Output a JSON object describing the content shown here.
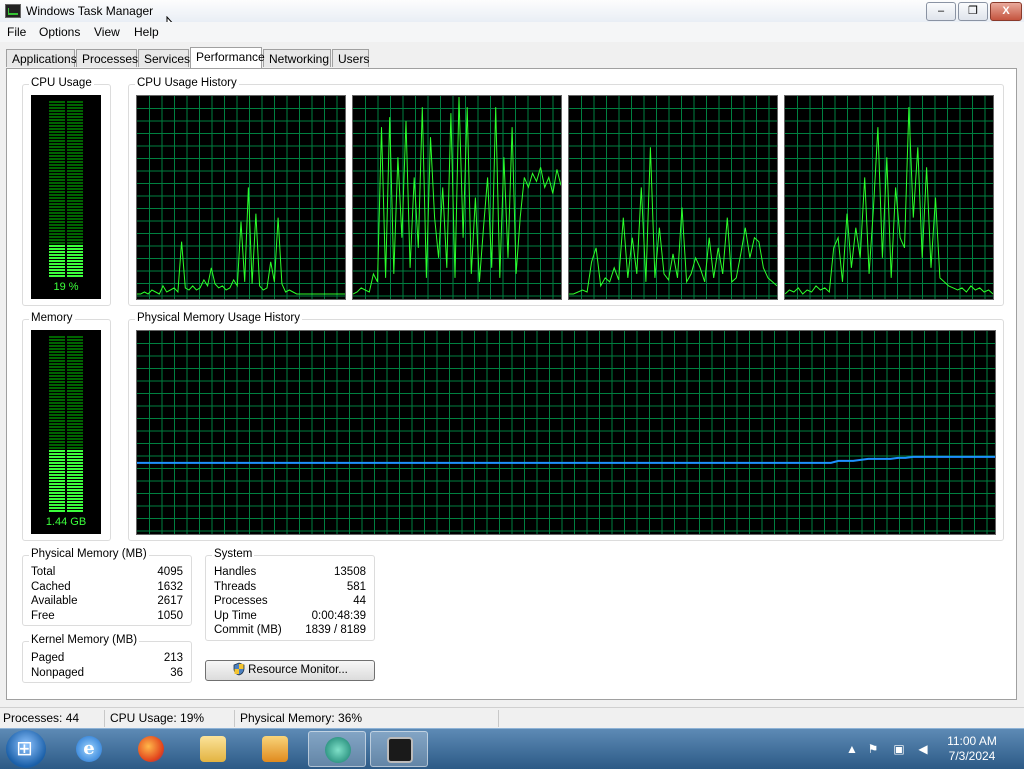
{
  "window": {
    "title": "Windows Task Manager",
    "min": "‒",
    "max": "❐",
    "close": "X"
  },
  "menu": [
    "File",
    "Options",
    "View",
    "Help"
  ],
  "tabs": [
    {
      "label": "Applications",
      "active": false
    },
    {
      "label": "Processes",
      "active": false
    },
    {
      "label": "Services",
      "active": false
    },
    {
      "label": "Performance",
      "active": true
    },
    {
      "label": "Networking",
      "active": false
    },
    {
      "label": "Users",
      "active": false
    }
  ],
  "cpu": {
    "label": "CPU Usage",
    "value_text": "19 %",
    "level": 0.19,
    "history_label": "CPU Usage History",
    "cores": [
      [
        2,
        2,
        3,
        2,
        4,
        3,
        2,
        6,
        3,
        4,
        5,
        3,
        28,
        5,
        4,
        6,
        4,
        5,
        9,
        6,
        15,
        7,
        5,
        6,
        4,
        5,
        9,
        6,
        38,
        8,
        55,
        7,
        42,
        6,
        4,
        5,
        18,
        8,
        40,
        7,
        3,
        4,
        3,
        2,
        2,
        2,
        2,
        2,
        2,
        2,
        2,
        2,
        2,
        2,
        2,
        2,
        2
      ],
      [
        2,
        3,
        5,
        4,
        3,
        12,
        8,
        85,
        10,
        90,
        12,
        70,
        30,
        88,
        15,
        60,
        25,
        95,
        10,
        80,
        40,
        20,
        55,
        15,
        92,
        10,
        100,
        30,
        95,
        12,
        50,
        8,
        35,
        60,
        15,
        95,
        10,
        70,
        20,
        85,
        12,
        40,
        60,
        55,
        62,
        58,
        65,
        55,
        60,
        52,
        64,
        56
      ],
      [
        2,
        2,
        3,
        4,
        3,
        18,
        25,
        6,
        10,
        8,
        15,
        9,
        40,
        10,
        30,
        12,
        55,
        8,
        75,
        10,
        35,
        12,
        9,
        22,
        10,
        45,
        8,
        12,
        20,
        15,
        8,
        30,
        10,
        25,
        12,
        40,
        8,
        10,
        22,
        35,
        20,
        30,
        28,
        15,
        10,
        8,
        6
      ],
      [
        2,
        4,
        3,
        5,
        2,
        4,
        3,
        6,
        4,
        5,
        3,
        25,
        30,
        8,
        42,
        15,
        35,
        20,
        60,
        12,
        45,
        85,
        20,
        70,
        10,
        55,
        30,
        25,
        95,
        40,
        75,
        20,
        65,
        15,
        50,
        10,
        8,
        6,
        5,
        4,
        5,
        3,
        6,
        4,
        5,
        3,
        4,
        2
      ]
    ]
  },
  "memory": {
    "label": "Memory",
    "value_text": "1.44 GB",
    "level": 0.36,
    "history_label": "Physical Memory Usage History",
    "history": [
      35,
      35,
      35,
      35,
      35,
      35,
      35,
      35,
      35,
      35,
      35,
      35,
      35,
      35,
      35,
      35,
      35,
      35,
      35,
      35,
      35,
      35,
      35,
      35,
      35,
      35,
      35,
      35,
      35,
      35,
      35,
      35,
      35,
      35,
      35,
      35,
      35,
      35,
      35,
      35,
      35,
      35,
      35,
      35,
      35,
      35,
      35,
      35,
      35,
      35,
      35,
      35,
      35,
      35,
      35,
      35,
      35,
      35,
      35,
      35,
      35,
      35,
      35,
      35,
      35,
      35,
      35,
      35,
      35,
      35,
      35,
      35,
      35,
      35,
      35,
      35,
      35,
      35,
      35,
      35,
      35,
      35,
      35,
      35,
      35,
      35,
      35,
      35,
      35,
      35,
      35,
      35,
      35,
      35,
      36,
      36,
      36,
      36.5,
      37,
      37,
      37,
      37,
      37.5,
      37.5,
      38,
      38,
      38,
      38,
      38,
      38,
      38,
      38,
      38,
      38,
      38,
      38
    ]
  },
  "physical_memory": {
    "title": "Physical Memory (MB)",
    "rows": [
      {
        "k": "Total",
        "v": "4095"
      },
      {
        "k": "Cached",
        "v": "1632"
      },
      {
        "k": "Available",
        "v": "2617"
      },
      {
        "k": "Free",
        "v": "1050"
      }
    ]
  },
  "kernel_memory": {
    "title": "Kernel Memory (MB)",
    "rows": [
      {
        "k": "Paged",
        "v": "213"
      },
      {
        "k": "Nonpaged",
        "v": "36"
      }
    ]
  },
  "system": {
    "title": "System",
    "rows": [
      {
        "k": "Handles",
        "v": "13508"
      },
      {
        "k": "Threads",
        "v": "581"
      },
      {
        "k": "Processes",
        "v": "44"
      },
      {
        "k": "Up Time",
        "v": "0:00:48:39"
      },
      {
        "k": "Commit (MB)",
        "v": "1839 / 8189"
      }
    ]
  },
  "resource_monitor_button": "Resource Monitor...",
  "status": {
    "processes": "Processes: 44",
    "cpu": "CPU Usage: 19%",
    "memory": "Physical Memory: 36%"
  },
  "taskbar": {
    "apps": [
      "internet-explorer-icon",
      "firefox-icon",
      "file-explorer-icon",
      "media-player-icon",
      "app-icon",
      "task-manager-icon"
    ],
    "time": "11:00 AM",
    "date": "7/3/2024"
  },
  "colors": {
    "graph_line": "#2bff2b",
    "grid": "#008040",
    "memory_line": "#1e90ff",
    "meter_on": "#3cff3c",
    "meter_off": "#006400"
  }
}
